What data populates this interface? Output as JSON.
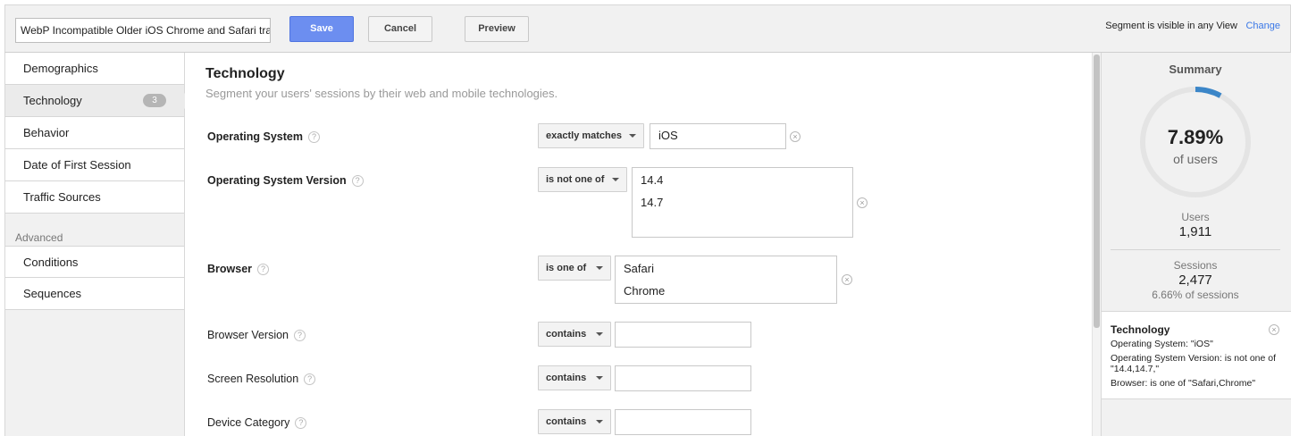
{
  "header": {
    "segment_name": "WebP Incompatible Older iOS Chrome and Safari tra",
    "save_label": "Save",
    "cancel_label": "Cancel",
    "preview_label": "Preview",
    "visibility_text": "Segment is visible in any View",
    "change_label": "Change"
  },
  "sidebar": {
    "items": [
      {
        "label": "Demographics"
      },
      {
        "label": "Technology",
        "badge": "3",
        "active": true
      },
      {
        "label": "Behavior"
      },
      {
        "label": "Date of First Session"
      },
      {
        "label": "Traffic Sources"
      }
    ],
    "advanced_label": "Advanced",
    "advanced_items": [
      {
        "label": "Conditions"
      },
      {
        "label": "Sequences"
      }
    ]
  },
  "main": {
    "title": "Technology",
    "subtitle": "Segment your users' sessions by their web and mobile technologies.",
    "help_glyph": "?",
    "clear_glyph": "×",
    "rows": [
      {
        "label": "Operating System",
        "operator": "exactly matches",
        "values": [
          "iOS"
        ]
      },
      {
        "label": "Operating System Version",
        "operator": "is not one of",
        "values": [
          "14.4",
          "14.7"
        ]
      },
      {
        "label": "Browser",
        "operator": "is one of",
        "values": [
          "Safari",
          "Chrome"
        ]
      },
      {
        "label": "Browser Version",
        "operator": "contains",
        "values": [
          ""
        ]
      },
      {
        "label": "Screen Resolution",
        "operator": "contains",
        "values": [
          ""
        ]
      },
      {
        "label": "Device Category",
        "operator": "contains",
        "values": [
          ""
        ]
      }
    ]
  },
  "summary": {
    "title": "Summary",
    "percent_value": 7.89,
    "percent": "7.89%",
    "percent_sub": "of users",
    "users_label": "Users",
    "users_value": "1,911",
    "sessions_label": "Sessions",
    "sessions_value": "2,477",
    "sessions_note": "6.66% of sessions",
    "card": {
      "title": "Technology",
      "lines": [
        "Operating System: \"iOS\"",
        "Operating System Version: is not one of \"14.4,14.7,\"",
        "Browser: is one of \"Safari,Chrome\""
      ]
    }
  },
  "colors": {
    "save_button": "#6c8ef0",
    "link": "#3b78e7",
    "donut_fill": "#3b86c8",
    "donut_track": "#e4e4e4"
  }
}
